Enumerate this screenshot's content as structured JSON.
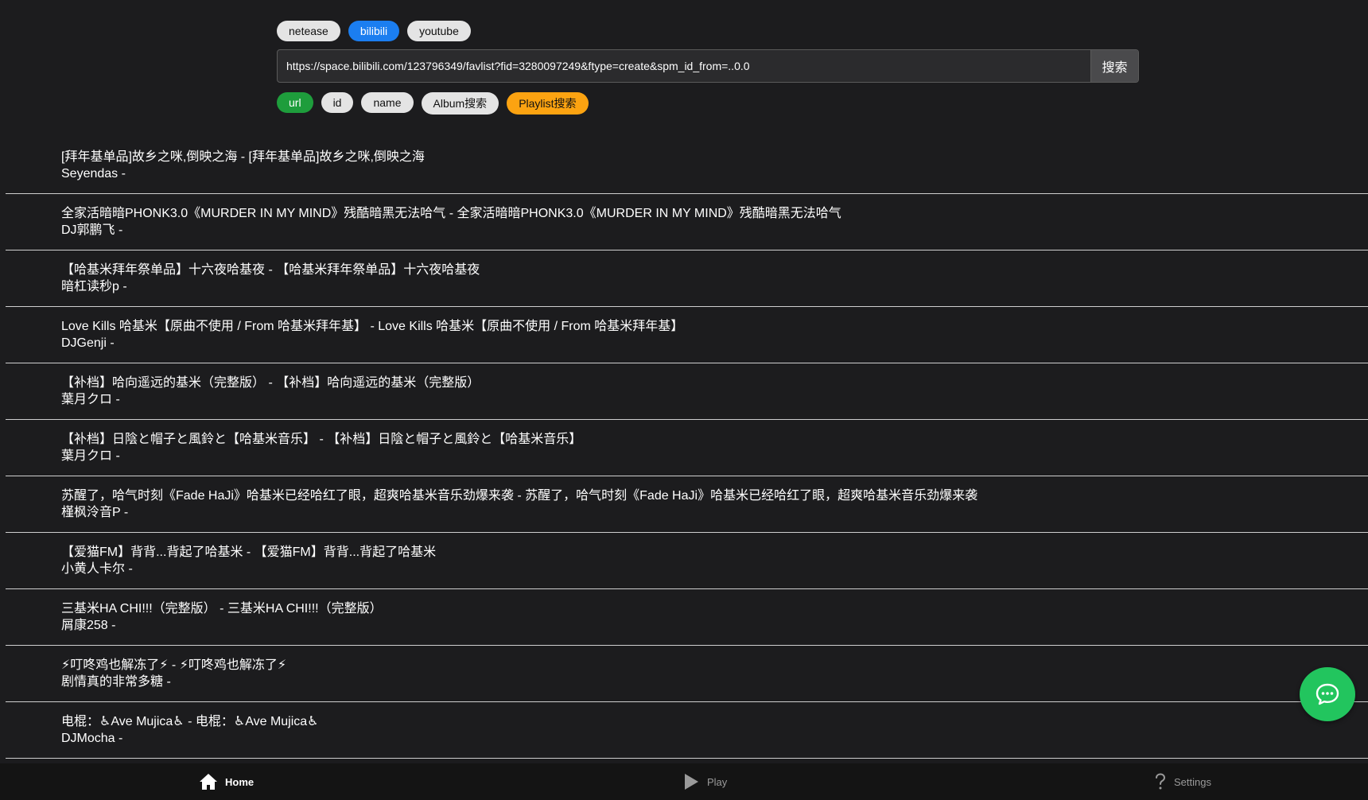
{
  "sources": [
    {
      "label": "netease",
      "active": false
    },
    {
      "label": "bilibili",
      "active": true
    },
    {
      "label": "youtube",
      "active": false
    }
  ],
  "search": {
    "value": "https://space.bilibili.com/123796349/favlist?fid=3280097249&ftype=create&spm_id_from=..0.0",
    "button_label": "搜索"
  },
  "modes": [
    {
      "label": "url",
      "active": true
    },
    {
      "label": "id",
      "active": false
    },
    {
      "label": "name",
      "active": false
    },
    {
      "label": "Album搜索",
      "active": false
    },
    {
      "label": "Playlist搜索",
      "active": false
    }
  ],
  "songs": [
    {
      "title": "[拜年基单品]故乡之咪,倒映之海 - [拜年基单品]故乡之咪,倒映之海",
      "artist": "Seyendas -"
    },
    {
      "title": "全家活暗暗PHONK3.0《MURDER IN MY MIND》残酷暗黑无法哈气 - 全家活暗暗PHONK3.0《MURDER IN MY MIND》残酷暗黑无法哈气",
      "artist": "DJ郭鹏飞 -"
    },
    {
      "title": "【哈基米拜年祭单品】十六夜哈基夜 - 【哈基米拜年祭单品】十六夜哈基夜",
      "artist": "暗杠读秒p -"
    },
    {
      "title": "Love Kills 哈基米【原曲不使用 / From 哈基米拜年基】 - Love Kills 哈基米【原曲不使用 / From 哈基米拜年基】",
      "artist": "DJGenji -"
    },
    {
      "title": "【补档】哈向遥远的基米（完整版） - 【补档】哈向遥远的基米（完整版）",
      "artist": "葉月クロ -"
    },
    {
      "title": "【补档】日陰と帽子と風鈴と【哈基米音乐】 - 【补档】日陰と帽子と風鈴と【哈基米音乐】",
      "artist": "葉月クロ -"
    },
    {
      "title": "苏醒了，哈气时刻《Fade HaJi》哈基米已经哈红了眼，超爽哈基米音乐劲爆来袭 - 苏醒了，哈气时刻《Fade HaJi》哈基米已经哈红了眼，超爽哈基米音乐劲爆来袭",
      "artist": "槿枫泠音P -"
    },
    {
      "title": "【爱猫FM】背背...背起了哈基米 - 【爱猫FM】背背...背起了哈基米",
      "artist": "小黄人卡尔 -"
    },
    {
      "title": "三基米HA CHI!!!（完整版） - 三基米HA CHI!!!（完整版）",
      "artist": "屑康258 -"
    },
    {
      "title": "⚡叮咚鸡也解冻了⚡ - ⚡叮咚鸡也解冻了⚡",
      "artist": "剧情真的非常多糖 -"
    },
    {
      "title": "电棍：♿Ave Mujica♿ - 电棍：♿Ave Mujica♿",
      "artist": "DJMocha -"
    }
  ],
  "nav": {
    "home": {
      "label": "Home",
      "icon": "home-icon",
      "active": true
    },
    "play": {
      "label": "Play",
      "icon": "play-icon",
      "active": false
    },
    "settings": {
      "label": "Settings",
      "icon": "help-icon",
      "active": false
    }
  },
  "fab": {
    "icon": "chat-icon"
  },
  "colors": {
    "background": "#1c1c1e",
    "active_source": "#1b7ef0",
    "active_mode": "#1e9d3c",
    "playlist_button": "#fca311",
    "fab": "#22c55e",
    "nav_background": "#141414"
  }
}
